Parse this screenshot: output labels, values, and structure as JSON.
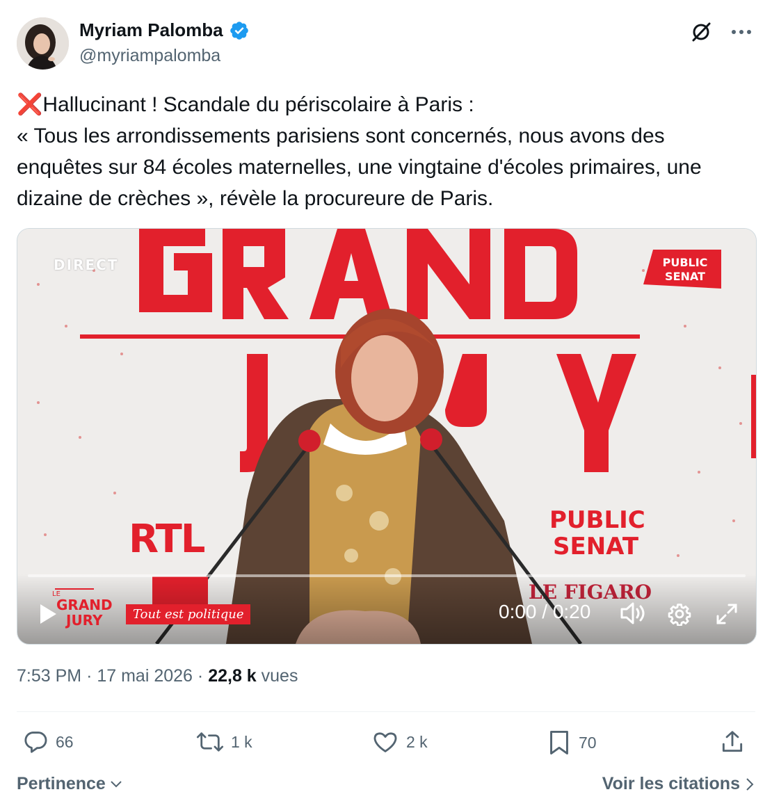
{
  "author": {
    "name": "Myriam Palomba",
    "handle": "@myriampalomba",
    "verified": true
  },
  "top_icons": [
    "grok-icon",
    "more-icon"
  ],
  "tweet": {
    "emoji": "❌",
    "line1": "Hallucinant ! Scandale du périscolaire à Paris :",
    "body": "« Tous les arrondissements parisiens sont concernés, nous avons des enquêtes sur 84 écoles maternelles, une vingtaine d'écoles primaires, une dizaine de crèches », révèle la procureure de Paris."
  },
  "video": {
    "live_label": "DIRECT",
    "channel_badge": [
      "PUBLIC",
      "SENAT"
    ],
    "backdrop_title": [
      "GRAND",
      "JURY"
    ],
    "backdrop_logos": [
      "RTL",
      "PUBLIC",
      "SENAT",
      "LE FIGARO"
    ],
    "mic_label": "RTL",
    "show_logo": [
      "LE",
      "GRAND",
      "JURY"
    ],
    "show_tagline": "Tout est politique",
    "time": "0:00 / 0:20",
    "progress": 0
  },
  "meta": {
    "time": "7:53 PM",
    "date": "17 mai 2026",
    "views_count": "22,8 k",
    "views_label": "vues"
  },
  "actions": {
    "replies": "66",
    "reposts": "1 k",
    "likes": "2 k",
    "bookmarks": "70"
  },
  "footer": {
    "sort_label": "Pertinence",
    "quotes_label": "Voir les citations"
  },
  "colors": {
    "text": "#0f1419",
    "secondary": "#536471",
    "verified": "#1d9bf0",
    "accent_red": "#e2202c"
  }
}
